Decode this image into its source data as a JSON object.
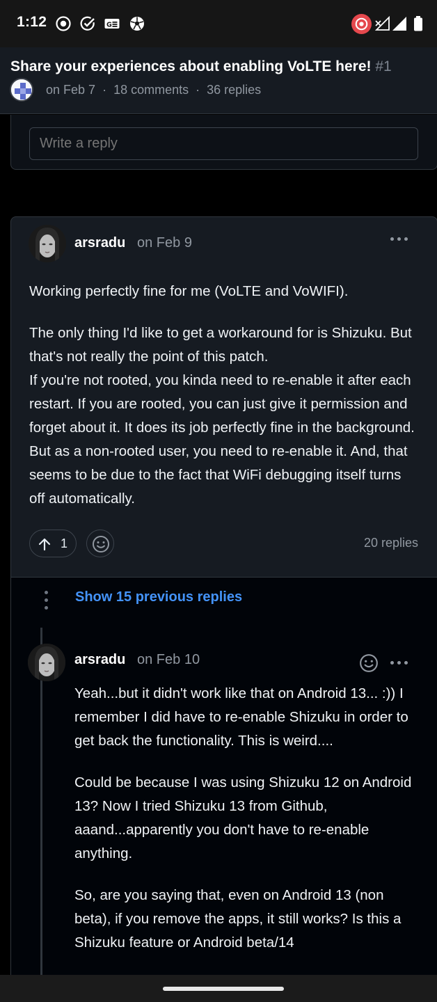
{
  "status_bar": {
    "time": "1:12",
    "left_icons": [
      "record-icon",
      "check-circle-icon",
      "gmail-icon",
      "soccer-ball-icon"
    ],
    "right_icons": [
      "hotspot-icon",
      "signal-no-data-icon",
      "signal-icon",
      "battery-icon"
    ]
  },
  "header": {
    "title": "Share your experiences about enabling VoLTE here!",
    "number": "#1",
    "date": "on Feb 7",
    "comments": "18 comments",
    "replies": "36 replies"
  },
  "reply_box": {
    "placeholder": "Write a reply"
  },
  "comment": {
    "author": "arsradu",
    "date": "on Feb 9",
    "paragraphs": [
      "Working perfectly fine for me (VoLTE and VoWIFI).",
      "The only thing I'd like to get a workaround for is Shizuku. But that's not really the point of this patch.\nIf you're not rooted, you kinda need to re-enable it after each restart. If you are rooted, you can just give it permission and forget about it. It does its job perfectly fine in the background. But as a non-rooted user, you need to re-enable it. And, that seems to be due to the fact that WiFi debugging itself turns off automatically."
    ],
    "upvotes": "1",
    "replies_label": "20 replies"
  },
  "thread": {
    "show_previous": "Show 15 previous replies",
    "reply": {
      "author": "arsradu",
      "date": "on Feb 10",
      "paragraphs": [
        "Yeah...but it didn't work like that on Android 13... :)) I remember I did have to re-enable Shizuku in order to get back the functionality. This is weird....",
        "Could be because I was using Shizuku 12 on Android 13? Now I tried Shizuku 13 from Github, aaand...apparently you don't have to re-enable anything.",
        "So, are you saying that, even on Android 13 (non beta), if you remove the apps, it still works? Is this a Shizuku feature or Android beta/14"
      ]
    }
  },
  "colors": {
    "background": "#000000",
    "card": "#161b22",
    "border": "#30363d",
    "link": "#4493f8",
    "muted": "#9198a1"
  }
}
